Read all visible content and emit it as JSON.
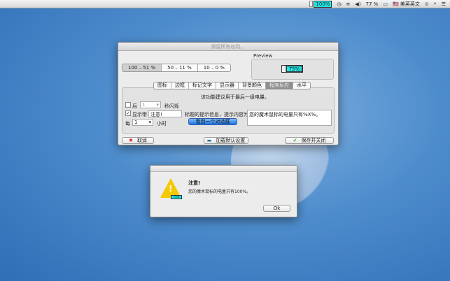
{
  "menubar": {
    "battery_app_pct": "100%",
    "battery_pct": "77 %",
    "input_source": "美英英文"
  },
  "main_window": {
    "title": "保留所有权利。",
    "ranges": [
      "100 – 51 %",
      "50 – 11 %",
      "10 – 0 %"
    ],
    "preview_label": "Preview",
    "preview_value": "75%",
    "tabs": [
      "图标",
      "边框",
      "标记文字",
      "显示器",
      "背景颜色",
      "程序反应",
      "水平"
    ],
    "active_tab": 5,
    "hint": "该功能建议用于最后一级电量。",
    "blink_prefix": "后",
    "blink_value": "1",
    "blink_suffix": "秒闪烁",
    "show_label": "显示带",
    "show_value": "注意!",
    "show_desc": "标题的提示信息，提示内容为",
    "message": "您的魔术鼠标的电量只有%X%。",
    "every_label": "每",
    "every_value": "1",
    "every_suffix": "小时",
    "preview_dialog_btn": "看到一个对话框",
    "cancel": "取消",
    "load_defaults": "加载默认设置",
    "save_close": "保存并关闭"
  },
  "alert": {
    "title": "注意!",
    "message": "您的魔术鼠标的电量只有100%。",
    "ok": "Ok",
    "icon_pct": "75%"
  }
}
